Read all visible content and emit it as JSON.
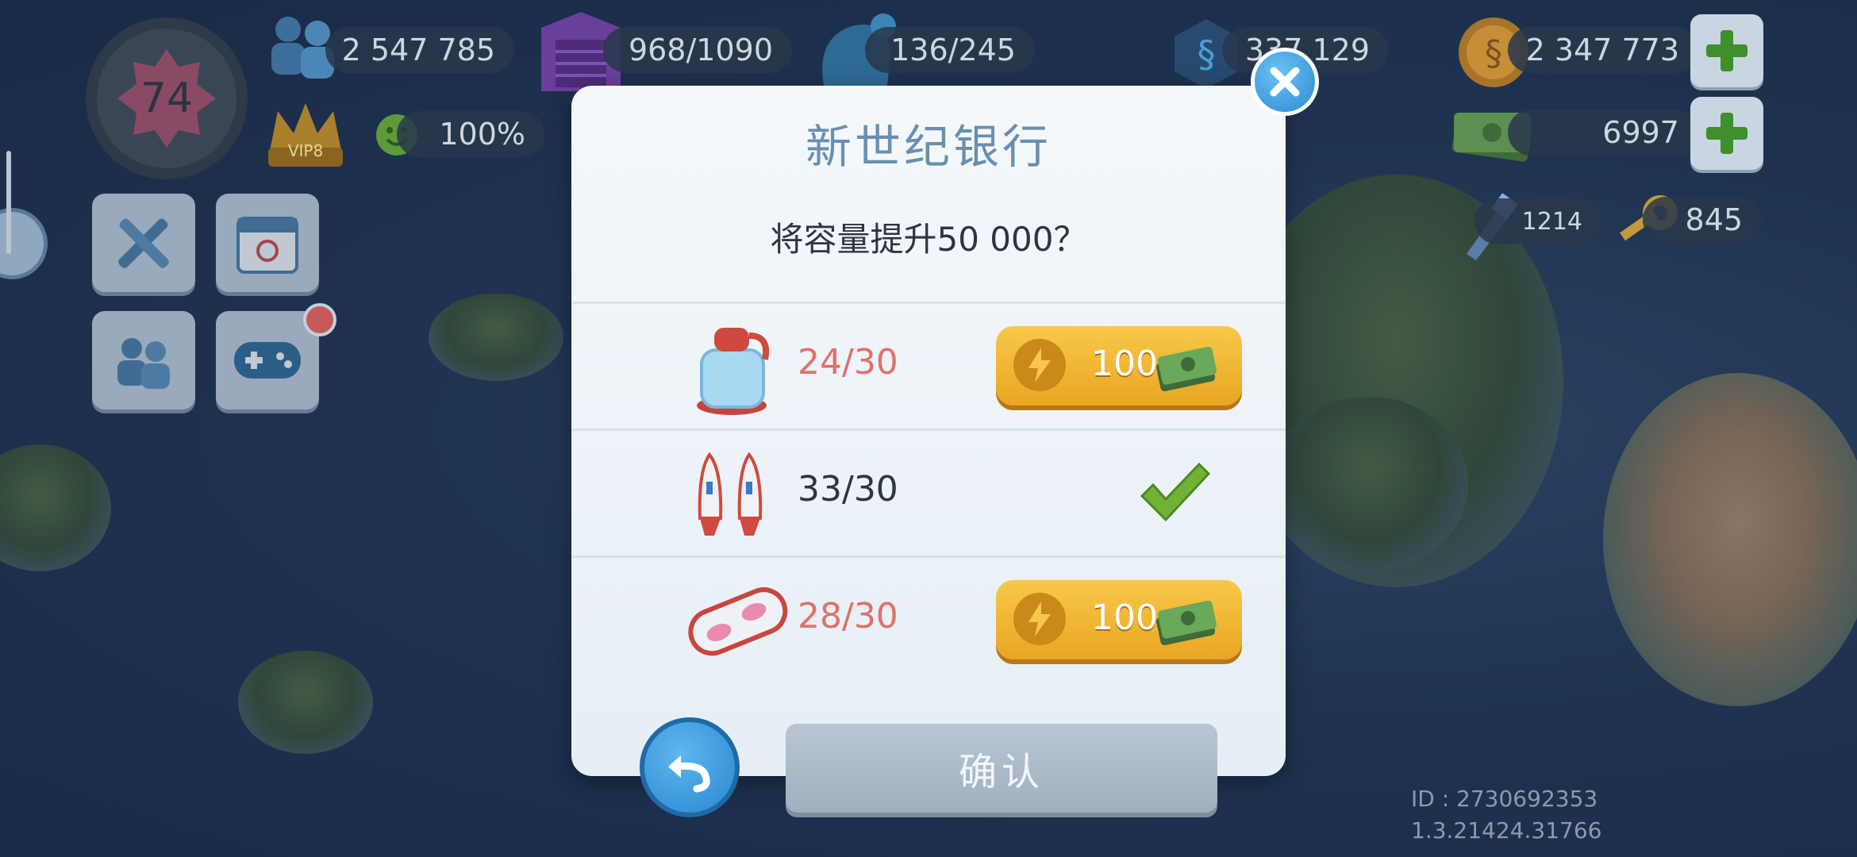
{
  "hud": {
    "population": "2 547 785",
    "storage": "968/1090",
    "workers": "136/245",
    "simoleons_partial": "337 129",
    "coins": "2 347 773",
    "cash": "6997",
    "happiness": "100%",
    "keys": "845",
    "gems": "1214",
    "level": "74",
    "vip_label": "VIP8"
  },
  "dialog": {
    "title": "新世纪银行",
    "question": "将容量提升50 000？",
    "items": [
      {
        "icon": "bottle-icon",
        "qty": "24/30",
        "status": "buy",
        "price": "100"
      },
      {
        "icon": "rocket-icon",
        "qty": "33/30",
        "status": "complete",
        "price": ""
      },
      {
        "icon": "hoverboard-icon",
        "qty": "28/30",
        "status": "buy",
        "price": "100"
      }
    ],
    "confirm_label": "确认"
  },
  "footer": {
    "id": "ID : 2730692353",
    "version": "1.3.21424.31766"
  },
  "colors": {
    "insufficient": "#e0706a",
    "sufficient": "#2e3440",
    "accent": "#6a8fae",
    "gold": "#f2b836"
  }
}
